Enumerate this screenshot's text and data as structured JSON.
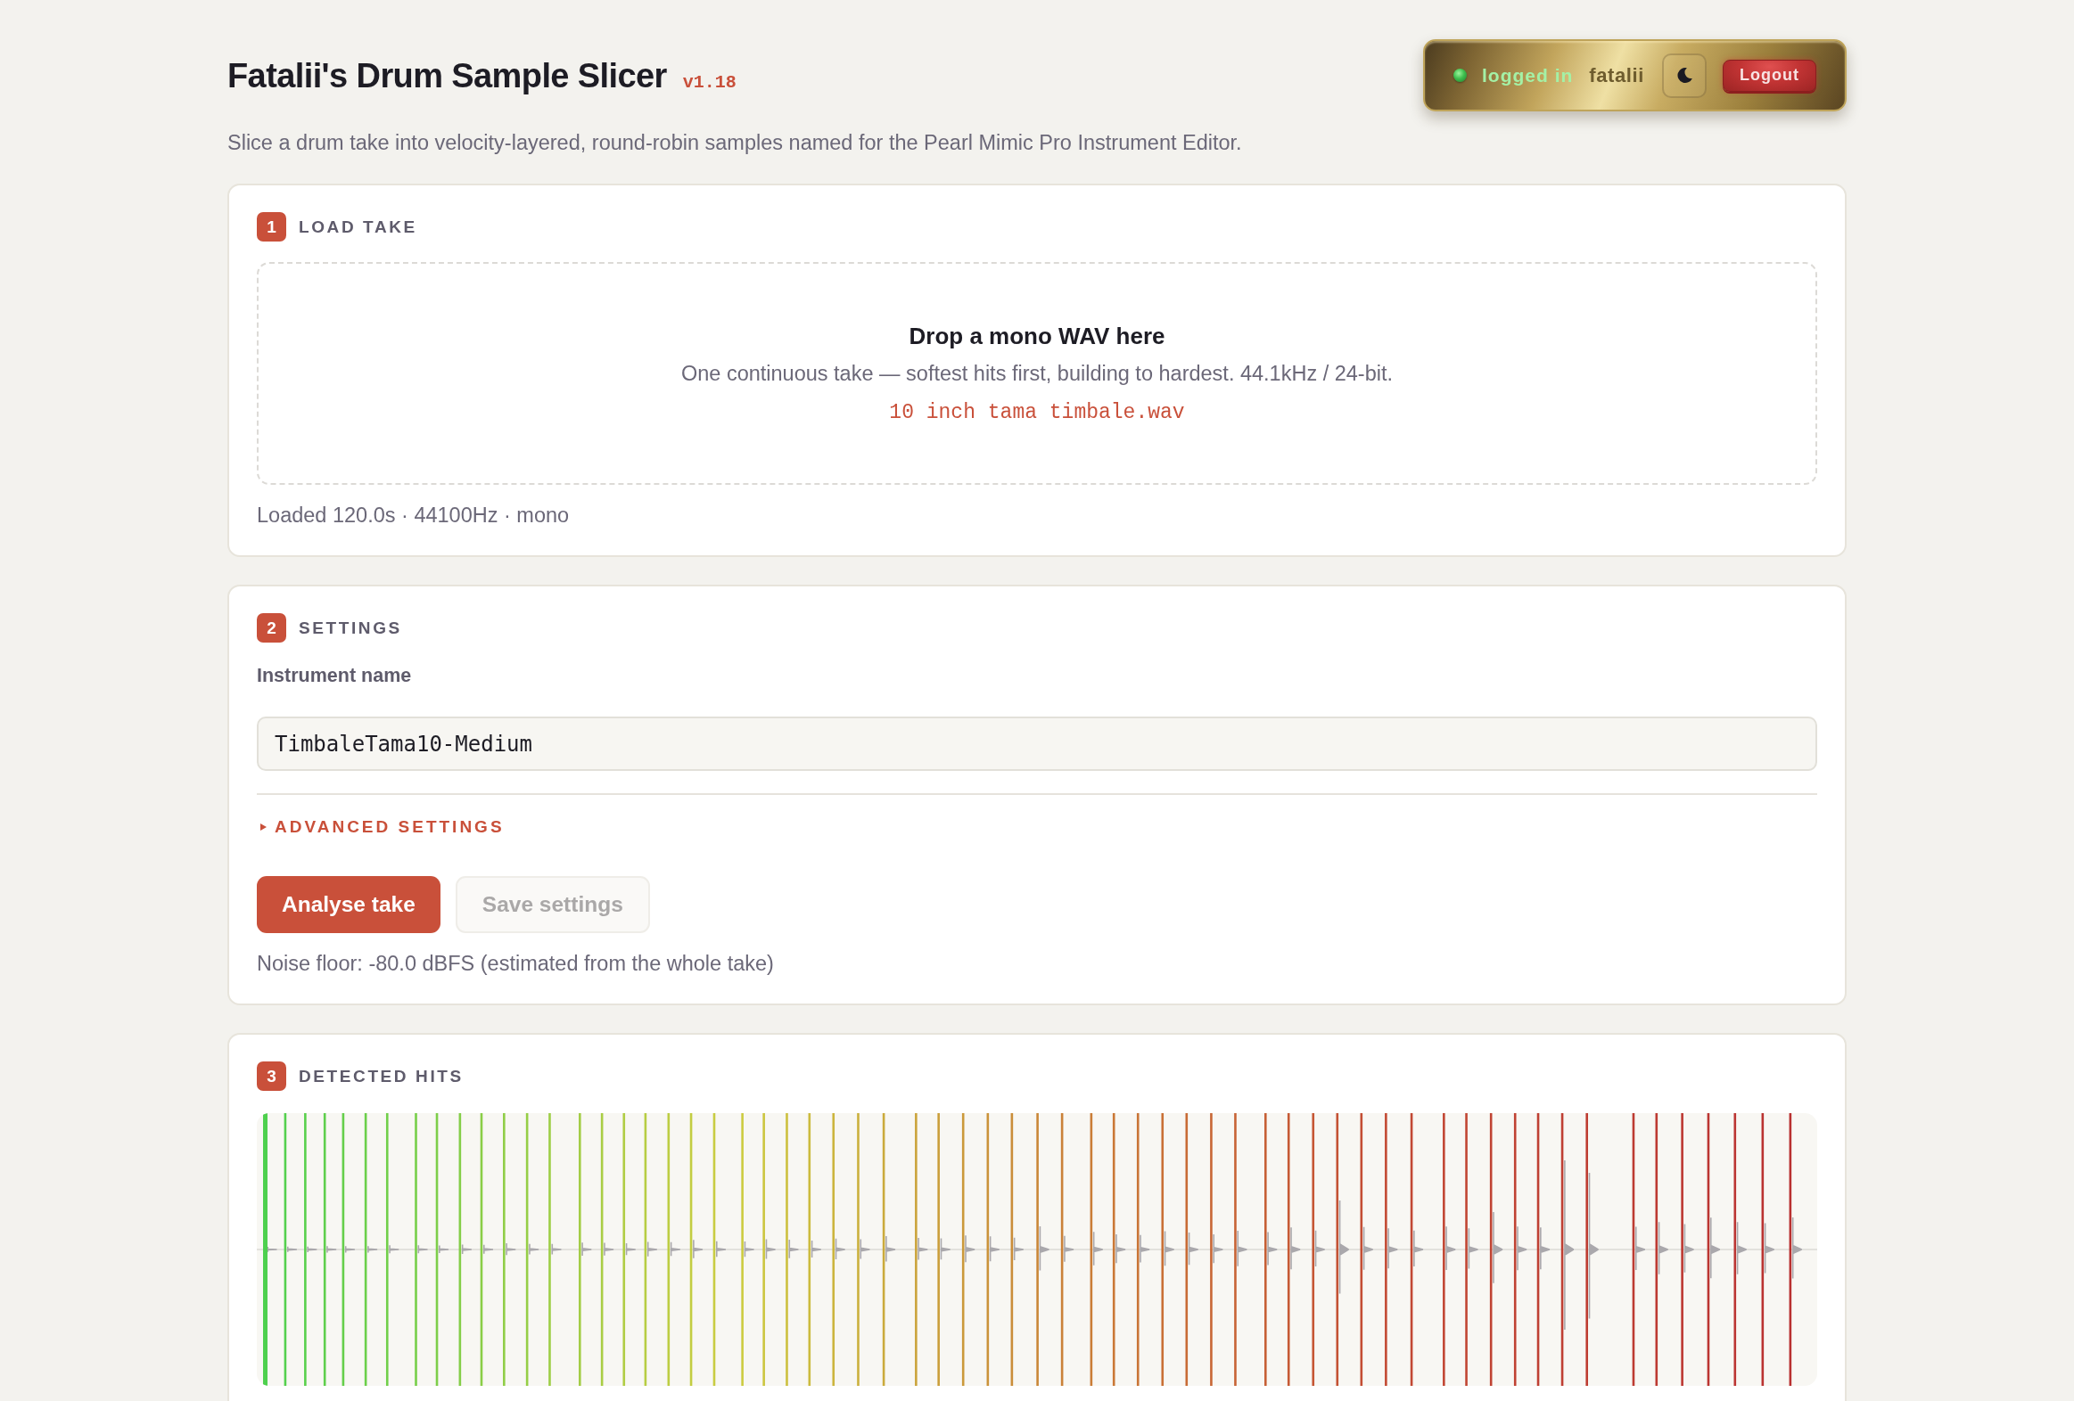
{
  "header": {
    "title": "Fatalii's Drum Sample Slicer",
    "version": "v1.18",
    "subtitle": "Slice a drum take into velocity-layered, round-robin samples named for the Pearl Mimic Pro Instrument Editor."
  },
  "session": {
    "online": true,
    "status": "logged in",
    "username": "fatalii",
    "logout_button": "Logout"
  },
  "sections": [
    {
      "kind": "load",
      "number": "1",
      "title": "LOAD TAKE",
      "drop_zone": {
        "title": "Drop a mono WAV here",
        "hint": "One continuous take — softest hits first, building to hardest. 44.1kHz / 24-bit.",
        "file_name": "10 inch tama timbale.wav"
      },
      "status": "Loaded 120.0s · 44100Hz · mono"
    },
    {
      "kind": "settings",
      "number": "2",
      "title": "SETTINGS",
      "field": {
        "label": "Instrument name",
        "value": "TimbaleTama10-Medium"
      },
      "advanced": {
        "label": "ADVANCED SETTINGS",
        "expanded": false
      },
      "buttons": [
        {
          "label": "Analyse take",
          "kind": "primary",
          "disabled": false
        },
        {
          "label": "Save settings",
          "kind": "secondary",
          "disabled": true
        }
      ],
      "note": "Noise floor: -80.0 dBFS (estimated from the whole take)"
    },
    {
      "kind": "hits",
      "number": "3",
      "title": "DETECTED HITS"
    }
  ]
}
